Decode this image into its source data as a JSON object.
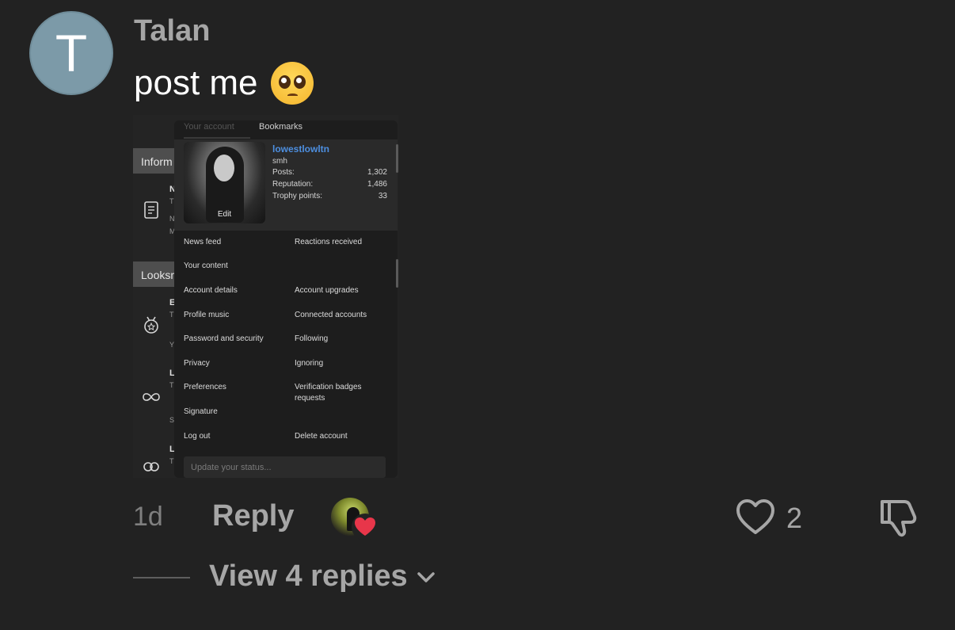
{
  "comment": {
    "avatar_letter": "T",
    "author": "Talan",
    "text": "post me",
    "emoji": "pleading-face-emoji",
    "time": "1d",
    "reply_label": "Reply",
    "like_count": "2",
    "view_replies_label": "View 4 replies"
  },
  "screenshot": {
    "background_sections": [
      "Inform",
      "Looksm"
    ],
    "tabs": {
      "account": "Your account",
      "bookmarks": "Bookmarks"
    },
    "profile": {
      "username": "lowestlowltn",
      "title": "smh",
      "edit_label": "Edit",
      "stats": [
        {
          "label": "Posts:",
          "value": "1,302"
        },
        {
          "label": "Reputation:",
          "value": "1,486"
        },
        {
          "label": "Trophy points:",
          "value": "33"
        }
      ]
    },
    "menu_left": [
      "News feed",
      "Your content",
      "Account details",
      "Profile music",
      "Password and security",
      "Privacy",
      "Preferences",
      "Signature",
      "Log out"
    ],
    "menu_right": [
      "Reactions received",
      "Account upgrades",
      "Connected accounts",
      "Following",
      "Ignoring",
      "Verification badges requests",
      "Delete account"
    ],
    "status_placeholder": "Update your status..."
  },
  "colors": {
    "background": "#222222",
    "username_link": "#4d8fe0",
    "heart_badge": "#e8364a"
  }
}
